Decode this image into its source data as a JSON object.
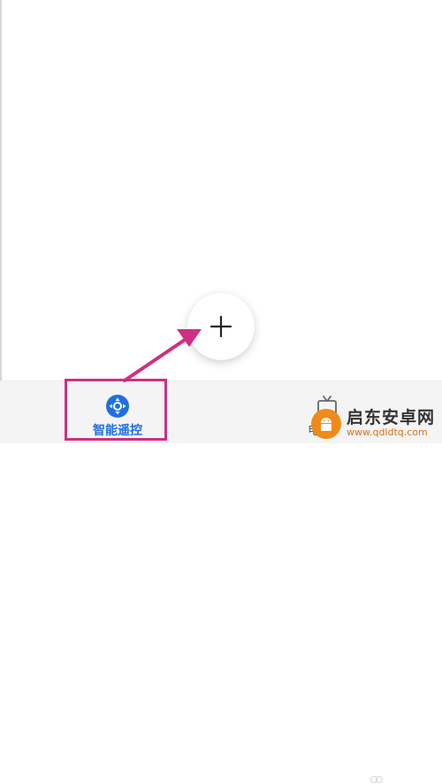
{
  "bottom_nav": {
    "items": [
      {
        "label": "智能遥控",
        "icon": "remote-control-icon",
        "active": true
      },
      {
        "label": "电",
        "icon": "tv-icon",
        "active": false
      }
    ]
  },
  "fab": {
    "icon": "plus-icon"
  },
  "colors": {
    "accent": "#1f6fe0",
    "annotation": "#cf2f82",
    "watermark_orange": "#f08a1a"
  },
  "watermark": {
    "title": "启东安卓网",
    "url": "www.qdldtq.com"
  }
}
